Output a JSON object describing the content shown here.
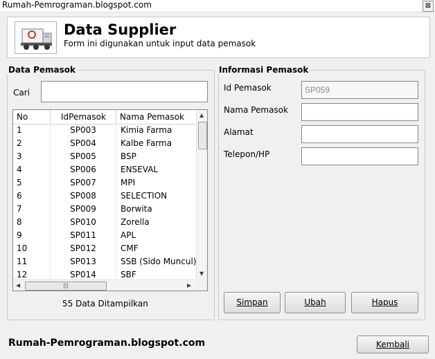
{
  "window": {
    "title": "Rumah-Pemrograman.blogspot.com",
    "close_glyph": "⊠"
  },
  "header": {
    "title": "Data Supplier",
    "subtitle": "Form ini digunakan untuk input data pemasok",
    "logo_icon": "truck-icon"
  },
  "left_group": {
    "label": "Data Pemasok",
    "search_label": "Cari",
    "search_value": "",
    "columns": [
      "No",
      "IdPemasok",
      "Nama Pemasok"
    ],
    "rows": [
      [
        "1",
        "SP003",
        "Kimia Farma"
      ],
      [
        "2",
        "SP004",
        "Kalbe Farma"
      ],
      [
        "3",
        "SP005",
        "BSP"
      ],
      [
        "4",
        "SP006",
        "ENSEVAL"
      ],
      [
        "5",
        "SP007",
        "MPI"
      ],
      [
        "6",
        "SP008",
        "SELECTION"
      ],
      [
        "7",
        "SP009",
        "Borwita"
      ],
      [
        "8",
        "SP010",
        "Zorella"
      ],
      [
        "9",
        "SP011",
        "APL"
      ],
      [
        "10",
        "SP012",
        "CMF"
      ],
      [
        "11",
        "SP013",
        "SSB (Sido Muncul)"
      ],
      [
        "12",
        "SP014",
        "SBF"
      ]
    ],
    "count_text": "55 Data Ditampilkan",
    "hthumb_glyph": "|||"
  },
  "right_group": {
    "label": "Informasi Pemasok",
    "fields": [
      {
        "label": "Id Pemasok",
        "value": "SP059"
      },
      {
        "label": "Nama Pemasok",
        "value": ""
      },
      {
        "label": "Alamat",
        "value": ""
      },
      {
        "label": "Telepon/HP",
        "value": ""
      }
    ],
    "buttons": {
      "save": "Simpan",
      "edit": "Ubah",
      "delete": "Hapus"
    }
  },
  "footer": {
    "text": "Rumah-Pemrograman.blogspot.com",
    "back_button": "Kembali"
  }
}
